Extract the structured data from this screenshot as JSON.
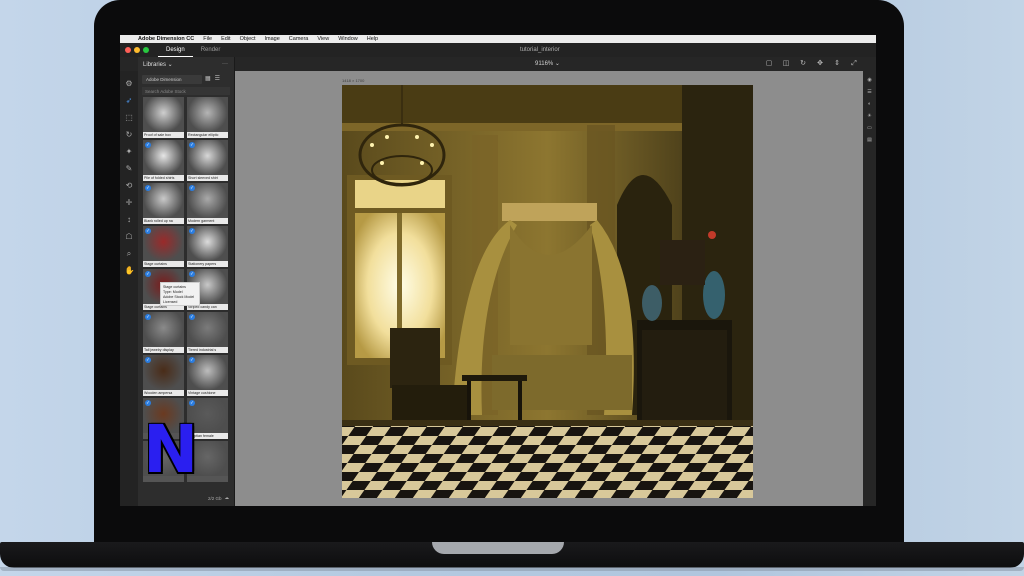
{
  "menubar": {
    "app_name": "Adobe Dimension CC",
    "items": [
      "File",
      "Edit",
      "Object",
      "Image",
      "Camera",
      "View",
      "Window",
      "Help"
    ]
  },
  "titlebar": {
    "tabs": [
      "Design",
      "Render"
    ],
    "active_tab": "Design",
    "document_title": "tutorial_interior"
  },
  "toolbar": {
    "zoom": "9116% ⌄"
  },
  "libraries": {
    "header": "Libraries ⌄",
    "more": "···",
    "selected_library": "Adobe Dimension",
    "search_placeholder": "Search Adobe Stock",
    "items": [
      {
        "label": "Proof of sale box",
        "checked": false
      },
      {
        "label": "Rectangular elliptic",
        "checked": false
      },
      {
        "label": "Pile of folded shirts",
        "checked": true
      },
      {
        "label": "Short sleeved shirt",
        "checked": true
      },
      {
        "label": "Blank rolled up na",
        "checked": true
      },
      {
        "label": "Modern garment",
        "checked": true
      },
      {
        "label": "Stage curtains",
        "checked": true
      },
      {
        "label": "Stationery papers",
        "checked": true
      },
      {
        "label": "Stage curtains",
        "checked": true
      },
      {
        "label": "Striped candy can",
        "checked": true
      },
      {
        "label": "Tall jewelry display",
        "checked": true
      },
      {
        "label": "Tiered industrial s",
        "checked": true
      },
      {
        "label": "Wooden ampersa",
        "checked": true
      },
      {
        "label": "Vintage cushione",
        "checked": true
      },
      {
        "label": "",
        "checked": true
      },
      {
        "label": "Egyptian female",
        "checked": true
      },
      {
        "label": "",
        "checked": false
      },
      {
        "label": "",
        "checked": false
      }
    ],
    "tooltip_lines": [
      "Stage curtains",
      "Type: Model",
      "Adobe Stock Model",
      "Licensed"
    ],
    "footer": "2/2 Gb"
  },
  "canvas": {
    "label": "1418 × 1700"
  },
  "overlay": {
    "logo_letter": "N"
  },
  "colors": {
    "accent_blue": "#2a7de1",
    "logo_blue": "#2a1ff0",
    "close": "#fe5f57",
    "minimize": "#febc2e",
    "maximize": "#28c840"
  }
}
